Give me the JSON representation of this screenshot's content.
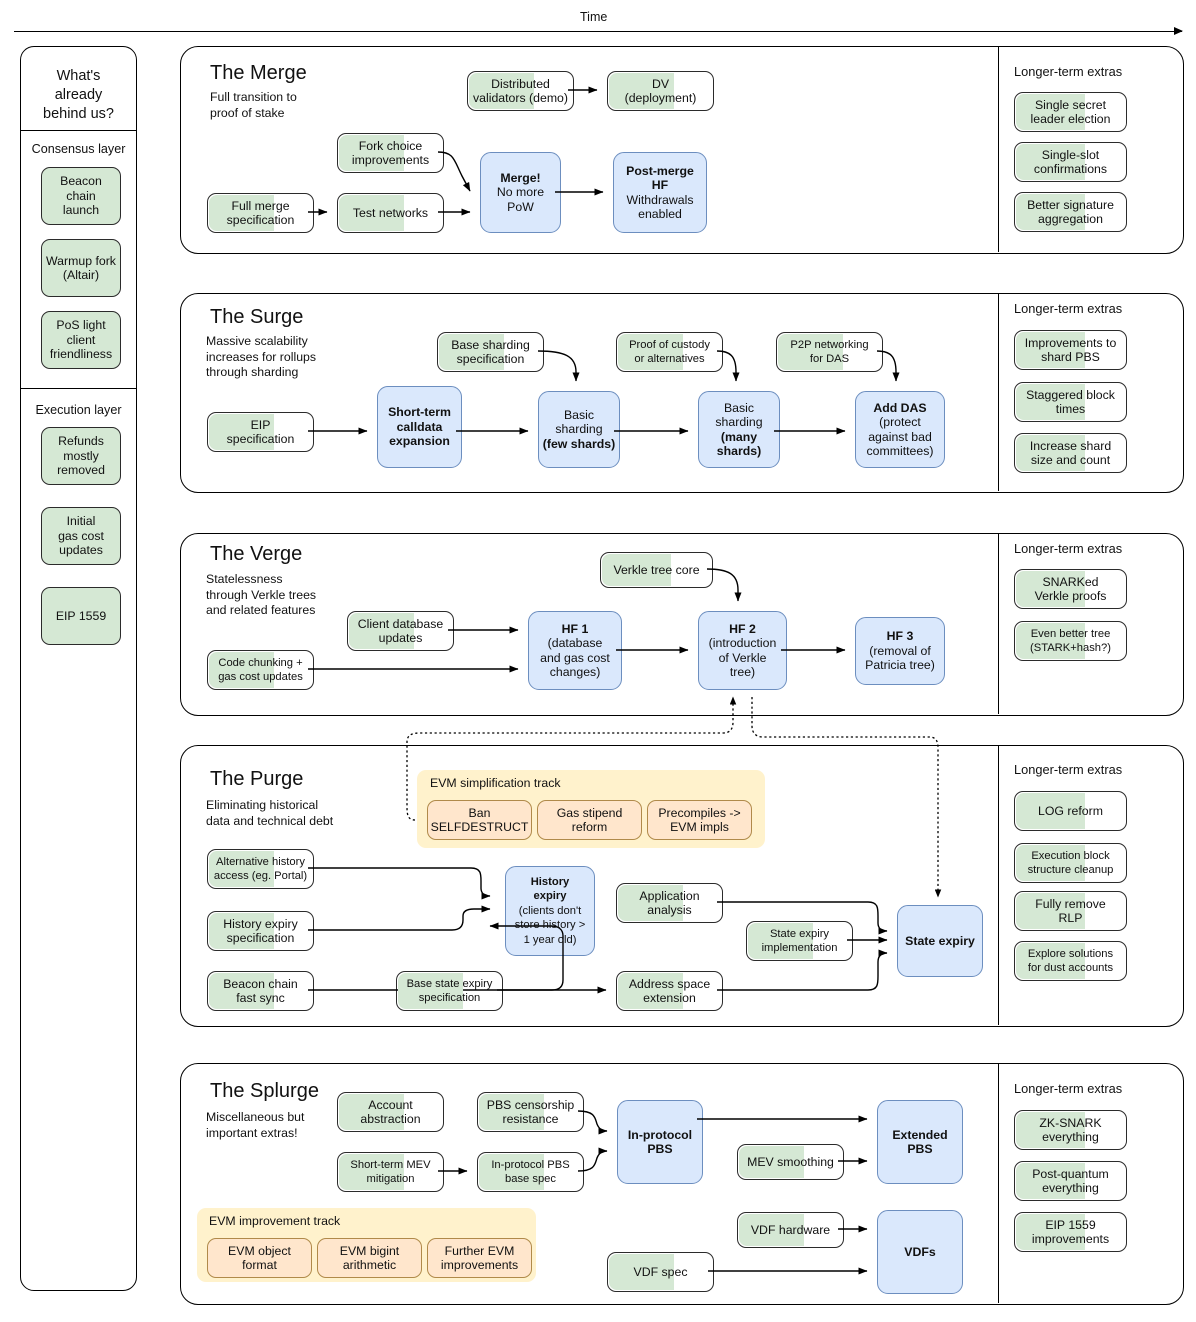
{
  "header": {
    "time_label": "Time"
  },
  "sidebar": {
    "title_lines": [
      "What's",
      "already",
      "behind us?"
    ],
    "groups": [
      {
        "label": "Consensus layer",
        "items": [
          {
            "lines": [
              "Beacon",
              "chain",
              "launch"
            ]
          },
          {
            "lines": [
              "Warmup fork",
              "(Altair)"
            ]
          },
          {
            "lines": [
              "PoS light",
              "client",
              "friendliness"
            ]
          }
        ]
      },
      {
        "label": "Execution layer",
        "items": [
          {
            "lines": [
              "Refunds",
              "mostly",
              "removed"
            ]
          },
          {
            "lines": [
              "Initial",
              "gas cost",
              "updates"
            ]
          },
          {
            "lines": [
              "EIP 1559"
            ]
          }
        ]
      }
    ]
  },
  "extras_heading": "Longer-term extras",
  "sections": [
    {
      "id": "merge",
      "title": "The Merge",
      "subtitle": [
        "Full transition to",
        "proof of stake"
      ],
      "nodes": [
        {
          "id": "dist-validators",
          "kind": "green",
          "lines": [
            "Distributed",
            "validators (demo)"
          ]
        },
        {
          "id": "dv-deployment",
          "kind": "green",
          "lines": [
            "DV",
            "(deployment)"
          ]
        },
        {
          "id": "fork-choice",
          "kind": "green",
          "lines": [
            "Fork choice",
            "improvements"
          ]
        },
        {
          "id": "full-merge-spec",
          "kind": "green",
          "lines": [
            "Full merge",
            "specification"
          ]
        },
        {
          "id": "test-networks",
          "kind": "green",
          "lines": [
            "Test networks"
          ]
        },
        {
          "id": "merge",
          "kind": "blue",
          "lines": [
            "Merge!",
            "No more",
            "PoW"
          ],
          "bold": [
            true,
            false,
            false
          ]
        },
        {
          "id": "post-merge-hf",
          "kind": "blue",
          "lines": [
            "Post-merge",
            "HF",
            "Withdrawals",
            "enabled"
          ],
          "bold": [
            true,
            true,
            false,
            false
          ]
        }
      ],
      "extras": [
        {
          "lines": [
            "Single secret",
            "leader election"
          ]
        },
        {
          "lines": [
            "Single-slot",
            "confirmations"
          ]
        },
        {
          "lines": [
            "Better signature",
            "aggregation"
          ]
        }
      ]
    },
    {
      "id": "surge",
      "title": "The Surge",
      "subtitle": [
        "Massive scalability",
        "increases for rollups",
        "through sharding"
      ],
      "nodes": [
        {
          "id": "base-sharding-spec",
          "kind": "green",
          "lines": [
            "Base sharding",
            "specification"
          ]
        },
        {
          "id": "proof-of-custody",
          "kind": "green",
          "lines": [
            "Proof of custody",
            "or alternatives"
          ]
        },
        {
          "id": "p2p-das",
          "kind": "green",
          "lines": [
            "P2P networking",
            "for DAS"
          ]
        },
        {
          "id": "eip-spec",
          "kind": "green",
          "lines": [
            "EIP",
            "specification"
          ]
        },
        {
          "id": "calldata-expansion",
          "kind": "blue",
          "lines": [
            "Short-term",
            "calldata",
            "expansion"
          ],
          "bold": [
            true,
            true,
            true
          ]
        },
        {
          "id": "basic-sharding-few",
          "kind": "blue",
          "lines": [
            "Basic",
            "sharding",
            "(few shards)"
          ]
        },
        {
          "id": "basic-sharding-many",
          "kind": "blue",
          "lines": [
            "Basic",
            "sharding",
            "(many",
            "shards)"
          ]
        },
        {
          "id": "add-das",
          "kind": "blue",
          "lines": [
            "Add DAS",
            "(protect",
            "against bad",
            "committees)"
          ]
        }
      ],
      "extras": [
        {
          "lines": [
            "Improvements to",
            "shard PBS"
          ]
        },
        {
          "lines": [
            "Staggered block",
            "times"
          ]
        },
        {
          "lines": [
            "Increase shard",
            "size and count"
          ]
        }
      ]
    },
    {
      "id": "verge",
      "title": "The Verge",
      "subtitle": [
        "Statelessness",
        "through Verkle trees",
        "and related features"
      ],
      "nodes": [
        {
          "id": "verkle-tree-core",
          "kind": "green",
          "lines": [
            "Verkle tree core"
          ]
        },
        {
          "id": "client-db-updates",
          "kind": "green",
          "lines": [
            "Client database",
            "updates"
          ]
        },
        {
          "id": "code-chunking",
          "kind": "green",
          "lines": [
            "Code chunking +",
            "gas cost updates"
          ]
        },
        {
          "id": "hf1",
          "kind": "blue",
          "lines": [
            "HF 1",
            "(database",
            "and gas cost",
            "changes)"
          ],
          "bold": [
            true,
            false,
            false,
            false
          ]
        },
        {
          "id": "hf2",
          "kind": "blue",
          "lines": [
            "HF 2",
            "(introduction",
            "of Verkle",
            "tree)"
          ],
          "bold": [
            true,
            false,
            false,
            false
          ]
        },
        {
          "id": "hf3",
          "kind": "blue",
          "lines": [
            "HF 3",
            "(removal of",
            "Patricia tree)"
          ],
          "bold": [
            true,
            false,
            false
          ]
        }
      ],
      "extras": [
        {
          "lines": [
            "SNARKed",
            "Verkle proofs"
          ]
        },
        {
          "lines": [
            "Even better tree",
            "(STARK+hash?)"
          ]
        }
      ]
    },
    {
      "id": "purge",
      "title": "The Purge",
      "subtitle": [
        "Eliminating historical",
        "data and technical debt"
      ],
      "track": {
        "label": "EVM simplification track",
        "items": [
          {
            "lines": [
              "Ban",
              "SELFDESTRUCT"
            ]
          },
          {
            "lines": [
              "Gas stipend",
              "reform"
            ]
          },
          {
            "lines": [
              "Precompiles ->",
              "EVM impls"
            ]
          }
        ]
      },
      "nodes": [
        {
          "id": "alt-history",
          "kind": "green",
          "lines": [
            "Alternative history",
            "access (eg. Portal)"
          ]
        },
        {
          "id": "history-expiry-spec",
          "kind": "green",
          "lines": [
            "History expiry",
            "specification"
          ]
        },
        {
          "id": "beacon-fast-sync",
          "kind": "green",
          "lines": [
            "Beacon chain",
            "fast sync"
          ]
        },
        {
          "id": "base-state-expiry-spec",
          "kind": "green",
          "lines": [
            "Base state expiry",
            "specification"
          ]
        },
        {
          "id": "application-analysis",
          "kind": "green",
          "lines": [
            "Application",
            "analysis"
          ]
        },
        {
          "id": "address-space-extension",
          "kind": "green",
          "lines": [
            "Address space",
            "extension"
          ]
        },
        {
          "id": "state-expiry-impl",
          "kind": "green",
          "lines": [
            "State expiry",
            "implementation"
          ]
        },
        {
          "id": "history-expiry",
          "kind": "blue",
          "lines": [
            "History",
            "expiry",
            "(clients don't",
            "store history >",
            "1 year old)"
          ],
          "bold": [
            true,
            true,
            false,
            false,
            false
          ]
        },
        {
          "id": "state-expiry",
          "kind": "blue",
          "lines": [
            "State expiry"
          ],
          "bold": [
            true
          ]
        }
      ],
      "extras": [
        {
          "lines": [
            "LOG reform"
          ]
        },
        {
          "lines": [
            "Execution block",
            "structure cleanup"
          ]
        },
        {
          "lines": [
            "Fully remove",
            "RLP"
          ]
        },
        {
          "lines": [
            "Explore solutions",
            "for dust accounts"
          ]
        }
      ]
    },
    {
      "id": "splurge",
      "title": "The Splurge",
      "subtitle": [
        "Miscellaneous but",
        "important extras!"
      ],
      "track": {
        "label": "EVM improvement track",
        "items": [
          {
            "lines": [
              "EVM object",
              "format"
            ]
          },
          {
            "lines": [
              "EVM bigint",
              "arithmetic"
            ]
          },
          {
            "lines": [
              "Further EVM",
              "improvements"
            ]
          }
        ]
      },
      "nodes": [
        {
          "id": "account-abstraction",
          "kind": "green",
          "lines": [
            "Account",
            "abstraction"
          ]
        },
        {
          "id": "pbs-censorship",
          "kind": "green",
          "lines": [
            "PBS censorship",
            "resistance"
          ]
        },
        {
          "id": "short-term-mev",
          "kind": "green",
          "lines": [
            "Short-term MEV",
            "mitigation"
          ]
        },
        {
          "id": "in-protocol-pbs-spec",
          "kind": "green",
          "lines": [
            "In-protocol PBS",
            "base spec"
          ]
        },
        {
          "id": "mev-smoothing",
          "kind": "green",
          "lines": [
            "MEV smoothing"
          ]
        },
        {
          "id": "vdf-hardware",
          "kind": "green",
          "lines": [
            "VDF hardware"
          ]
        },
        {
          "id": "vdf-spec",
          "kind": "green",
          "lines": [
            "VDF spec"
          ]
        },
        {
          "id": "in-protocol-pbs",
          "kind": "blue",
          "lines": [
            "In-protocol",
            "PBS"
          ],
          "bold": [
            true,
            true
          ]
        },
        {
          "id": "extended-pbs",
          "kind": "blue",
          "lines": [
            "Extended",
            "PBS"
          ],
          "bold": [
            true,
            true
          ]
        },
        {
          "id": "vdfs",
          "kind": "blue",
          "lines": [
            "VDFs"
          ],
          "bold": [
            true
          ]
        }
      ],
      "extras": [
        {
          "lines": [
            "ZK-SNARK",
            "everything"
          ]
        },
        {
          "lines": [
            "Post-quantum",
            "everything"
          ]
        },
        {
          "lines": [
            "EIP 1559",
            "improvements"
          ]
        }
      ]
    }
  ],
  "colors": {
    "green": "#d5e8d4",
    "blue": "#dae8fc",
    "blue_border": "#6c8ebf",
    "amber_track": "#fff2cc",
    "amber_node": "#ffe6cc",
    "stroke": "#000000"
  }
}
